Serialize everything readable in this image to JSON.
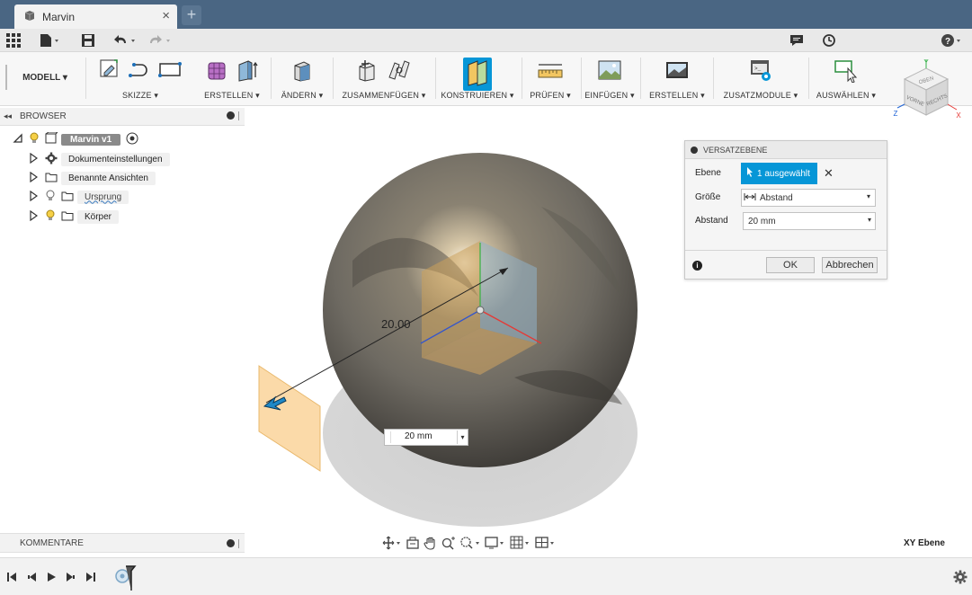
{
  "window": {
    "tab_title": "Marvin",
    "tab_close": "×",
    "new_tab": "+"
  },
  "ribbon": {
    "workspace": "MODELL ▾",
    "groups": [
      {
        "label": "SKIZZE ▾"
      },
      {
        "label": "ERSTELLEN ▾"
      },
      {
        "label": "ÄNDERN ▾"
      },
      {
        "label": "ZUSAMMENFÜGEN ▾"
      },
      {
        "label": "KONSTRUIEREN ▾"
      },
      {
        "label": "PRÜFEN ▾"
      },
      {
        "label": "EINFÜGEN ▾"
      },
      {
        "label": "ERSTELLEN ▾"
      },
      {
        "label": "ZUSATZMODULE ▾"
      },
      {
        "label": "AUSWÄHLEN ▾"
      }
    ]
  },
  "viewcube": {
    "top": "OBEN",
    "front": "VORNE",
    "right": "RECHTS",
    "axis_x": "X",
    "axis_y": "Y",
    "axis_z": "Z"
  },
  "browser": {
    "title": "BROWSER",
    "root": "Marvin v1",
    "items": [
      {
        "label": "Dokumenteinstellungen"
      },
      {
        "label": "Benannte Ansichten"
      },
      {
        "label": "Ursprung"
      },
      {
        "label": "Körper"
      }
    ]
  },
  "viewport": {
    "dimension_label": "20.00",
    "input_value": "20 mm",
    "plane_label": "XY Ebene"
  },
  "dialog": {
    "title": "VERSATZEBENE",
    "rows": {
      "ebene_label": "Ebene",
      "ebene_value": "1 ausgewählt",
      "groesse_label": "Größe",
      "groesse_value": "Abstand",
      "abstand_label": "Abstand",
      "abstand_value": "20 mm"
    },
    "ok": "OK",
    "cancel": "Abbrechen"
  },
  "comments": {
    "title": "KOMMENTARE"
  },
  "colors": {
    "tabbar": "#4a6683",
    "accent_blue": "#0696d7",
    "plane_fill": "#fbd9a5"
  }
}
